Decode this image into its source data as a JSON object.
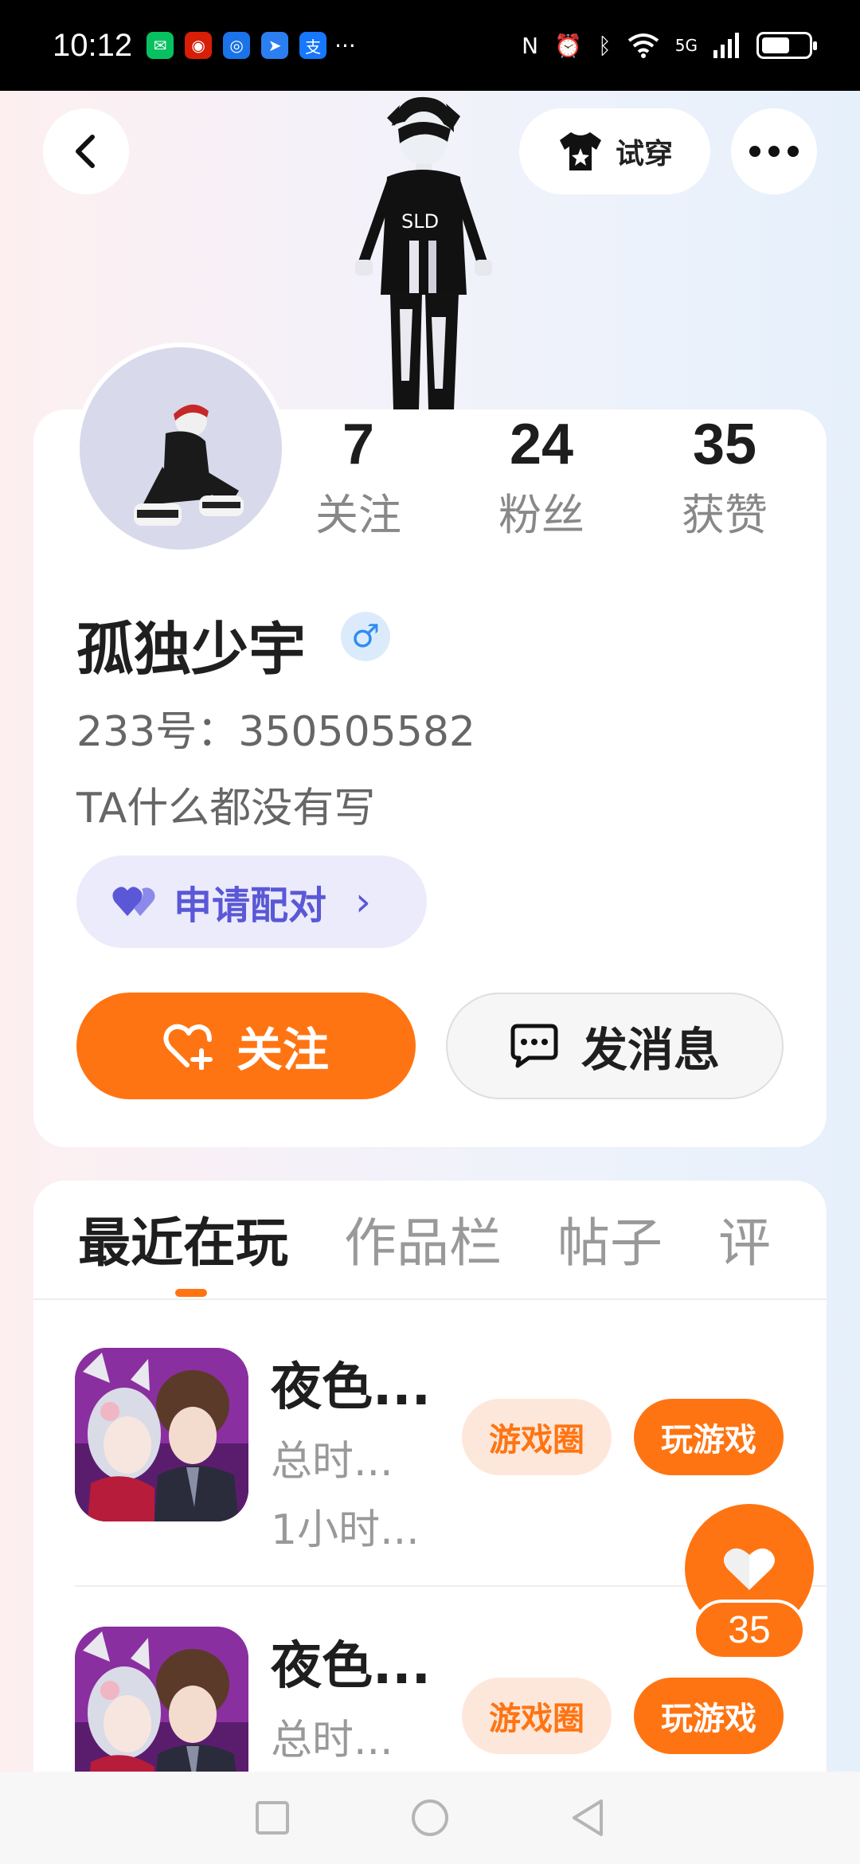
{
  "status_bar": {
    "time": "10:12",
    "more": "···",
    "network": "5G",
    "apps": [
      {
        "name": "wechat-icon",
        "color": "#07c160",
        "glyph": "✉"
      },
      {
        "name": "bank-icon",
        "color": "#d81e06",
        "glyph": "◉"
      },
      {
        "name": "app-icon-blue",
        "color": "#1a73e8",
        "glyph": "◎"
      },
      {
        "name": "app-icon-send",
        "color": "#2b7ff0",
        "glyph": "➤"
      },
      {
        "name": "alipay-icon",
        "color": "#1677ff",
        "glyph": "支"
      }
    ]
  },
  "header": {
    "tryon_label": "试穿"
  },
  "profile": {
    "stats": [
      {
        "value": "7",
        "label": "关注"
      },
      {
        "value": "24",
        "label": "粉丝"
      },
      {
        "value": "35",
        "label": "获赞"
      }
    ],
    "username": "孤独少宇",
    "gender_symbol": "♂",
    "uid": "233号：350505582",
    "bio": "TA什么都没有写",
    "pair_label": "申请配对",
    "pair_arrow": "›",
    "follow_label": "关注",
    "message_label": "发消息"
  },
  "tabs": [
    {
      "label": "最近在玩",
      "active": true
    },
    {
      "label": "作品栏",
      "active": false
    },
    {
      "label": "帖子",
      "active": false
    },
    {
      "label": "评",
      "active": false
    }
  ],
  "games": [
    {
      "title": "夜色...",
      "sub1": "总时...",
      "sub2": "1小时...",
      "circle_label": "游戏圈",
      "play_label": "玩游戏"
    },
    {
      "title": "夜色...",
      "sub1": "总时...",
      "sub2": "",
      "circle_label": "游戏圈",
      "play_label": "玩游戏"
    }
  ],
  "like": {
    "count": "35"
  },
  "colors": {
    "accent": "#ff7412",
    "pair": "#5a58d6",
    "gender": "#2f8df1"
  }
}
